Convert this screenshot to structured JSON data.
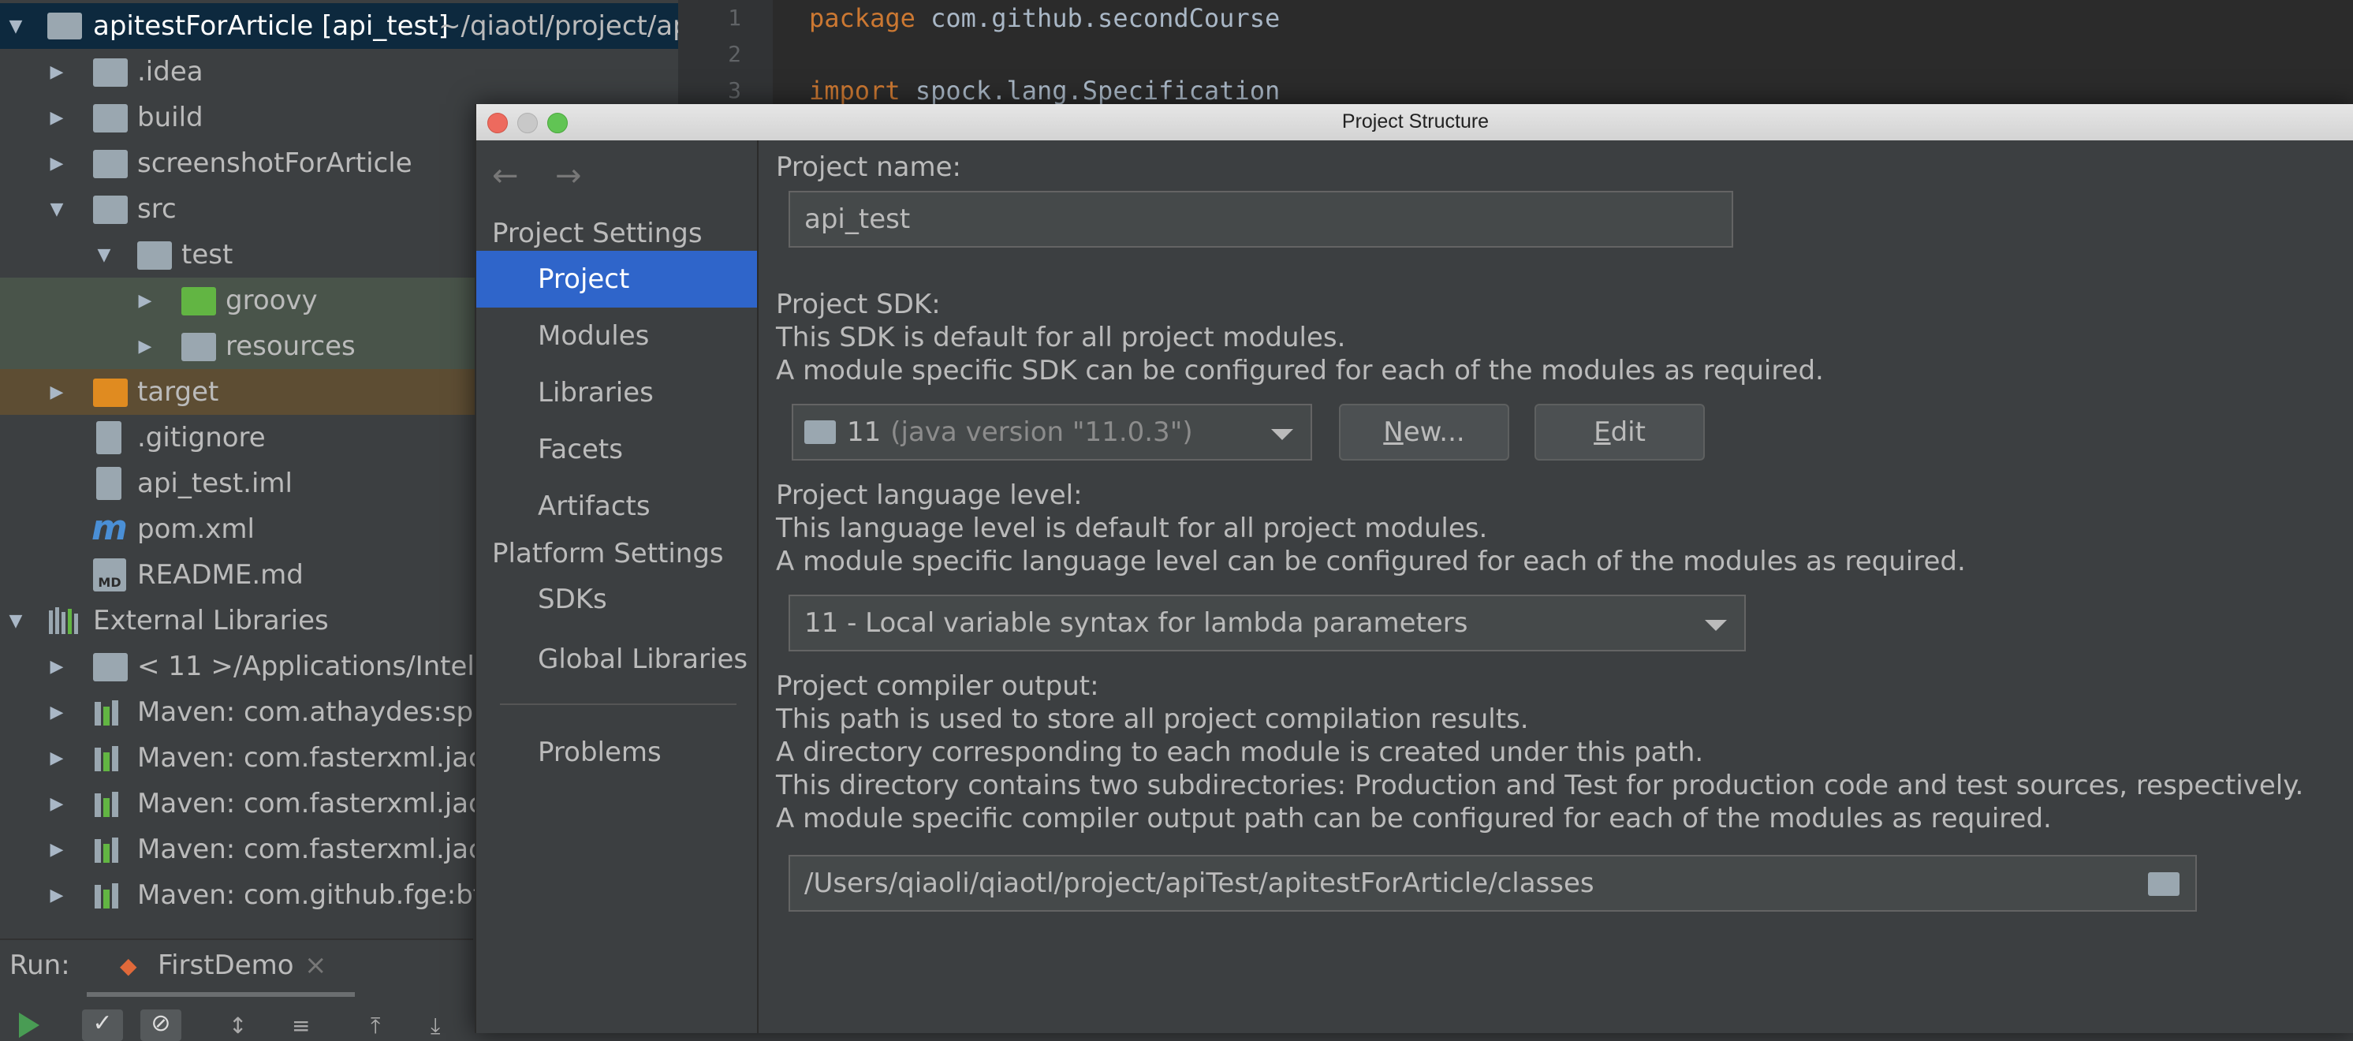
{
  "project_tree": {
    "root_name": "apitestForArticle [api_test]",
    "root_path": "~/qiaotl/project/apiT",
    "items": [
      {
        "label": ".idea"
      },
      {
        "label": "build"
      },
      {
        "label": "screenshotForArticle"
      },
      {
        "label": "src"
      },
      {
        "label": "test"
      },
      {
        "label": "groovy"
      },
      {
        "label": "resources"
      },
      {
        "label": "target"
      },
      {
        "label": ".gitignore"
      },
      {
        "label": "api_test.iml"
      },
      {
        "label": "pom.xml"
      },
      {
        "label": "README.md"
      },
      {
        "label": "External Libraries"
      },
      {
        "label": "< 11 >",
        "path": "/Applications/IntelliJ"
      },
      {
        "label": "Maven: com.athaydes:spoc"
      },
      {
        "label": "Maven: com.fasterxml.jack"
      },
      {
        "label": "Maven: com.fasterxml.jack"
      },
      {
        "label": "Maven: com.fasterxml.jack"
      },
      {
        "label": "Maven: com.github.fge:btf:"
      }
    ],
    "icon_markers": {
      "md": "MD",
      "maven": "m"
    }
  },
  "editor": {
    "lines": [
      {
        "num": "1",
        "kw": "package",
        "rest": " com.github.secondCourse"
      },
      {
        "num": "2",
        "kw": "",
        "rest": ""
      },
      {
        "num": "3",
        "kw": "import",
        "rest": " spock.lang.Specification"
      }
    ]
  },
  "run_bar": {
    "label": "Run:",
    "tab": "FirstDemo"
  },
  "dialog": {
    "title": "Project Structure",
    "nav": {
      "project_settings_header": "Project Settings",
      "project": "Project",
      "modules": "Modules",
      "libraries": "Libraries",
      "facets": "Facets",
      "artifacts": "Artifacts",
      "platform_settings_header": "Platform Settings",
      "sdks": "SDKs",
      "global_libraries": "Global Libraries",
      "problems": "Problems"
    },
    "content": {
      "project_name_label": "Project name:",
      "project_name_value": "api_test",
      "sdk_label": "Project SDK:",
      "sdk_desc1": "This SDK is default for all project modules.",
      "sdk_desc2": "A module specific SDK can be configured for each of the modules as required.",
      "sdk_value": "11",
      "sdk_version": "(java version \"11.0.3\")",
      "new_button_n": "N",
      "new_button_rest": "ew...",
      "edit_button_e": "E",
      "edit_button_rest": "dit",
      "lang_label": "Project language level:",
      "lang_desc1": "This language level is default for all project modules.",
      "lang_desc2": "A module specific language level can be configured for each of the modules as required.",
      "lang_value": "11 - Local variable syntax for lambda parameters",
      "compiler_label": "Project compiler output:",
      "compiler_desc1": "This path is used to store all project compilation results.",
      "compiler_desc2": "A directory corresponding to each module is created under this path.",
      "compiler_desc3": "This directory contains two subdirectories: Production and Test for production code and test sources, respectively.",
      "compiler_desc4": "A module specific compiler output path can be configured for each of the modules as required.",
      "compiler_path": "/Users/qiaoli/qiaotl/project/apiTest/apitestForArticle/classes"
    }
  },
  "colors": {
    "selection": "#2f65ca",
    "background": "#3c3f41",
    "keyword": "#cc7832"
  }
}
